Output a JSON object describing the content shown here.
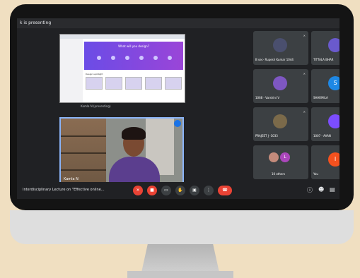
{
  "meeting": {
    "presenting_text": "k is presenting",
    "title": "Interdisciplinary Lecture on \"Effective online..."
  },
  "screen_share": {
    "banner_title": "What will you design?",
    "section_label": "Design spotlight",
    "presenter_label": "Kamla N (presenting)"
  },
  "camera": {
    "name": "Kamla N"
  },
  "participants": [
    {
      "name": "B sec- Rupesh Kumar 1044",
      "avatar_color": "#4a4f6e"
    },
    {
      "name": "TITTALA BHAR",
      "avatar_color": "#6a5acd"
    },
    {
      "name": "1068 - Varshini V",
      "avatar_color": "#7e57c2"
    },
    {
      "name": "SHARMILA",
      "avatar_color": "#1e88e5",
      "initial": "S"
    },
    {
      "name": "PRAJEET J -1033",
      "avatar_color": "#7b6a4a"
    },
    {
      "name": "1007 - AVAN",
      "avatar_color": "#7c4dff"
    },
    {
      "name": "10 others",
      "avatar_color": "#ab47bc",
      "initial": "L"
    },
    {
      "name": "You",
      "avatar_color": "#f4511e",
      "initial": "I"
    }
  ],
  "controls": {
    "mic_color": "#ea4335",
    "cam_color": "#ea4335",
    "end_color": "#ea4335",
    "neutral_color": "#3c4043"
  },
  "icons": [
    "mic-off-icon",
    "camera-off-icon",
    "captions-icon",
    "raise-hand-icon",
    "present-icon",
    "more-icon",
    "end-call-icon",
    "info-icon",
    "people-icon",
    "chat-icon"
  ]
}
